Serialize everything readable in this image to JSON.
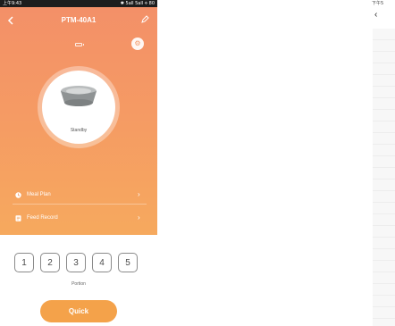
{
  "left_phone": {
    "status_bar": {
      "time": "上午9:43",
      "indicators": "✱ 5all 5all ⟡ 80"
    },
    "nav": {
      "back_icon": "chevron-left-icon",
      "title": "PTM-40A1",
      "edit_icon": "pencil-icon"
    },
    "device": {
      "status": "Standby",
      "settings_icon": "gear-icon",
      "battery_icon": "battery-icon"
    },
    "menu": [
      {
        "label": "Meal Plan",
        "icon": "clock-icon"
      },
      {
        "label": "Feed Record",
        "icon": "document-icon"
      }
    ],
    "portion": {
      "options": [
        "1",
        "2",
        "3",
        "4",
        "5"
      ],
      "label": "Portion"
    },
    "quick_button": "Quick",
    "colors": {
      "gradient_top": "#f39068",
      "gradient_bottom": "#f6a95e",
      "quick": "#f4a24a"
    }
  },
  "right_phone": {
    "status_time": "下午5",
    "back_icon": "chevron-left-icon"
  }
}
